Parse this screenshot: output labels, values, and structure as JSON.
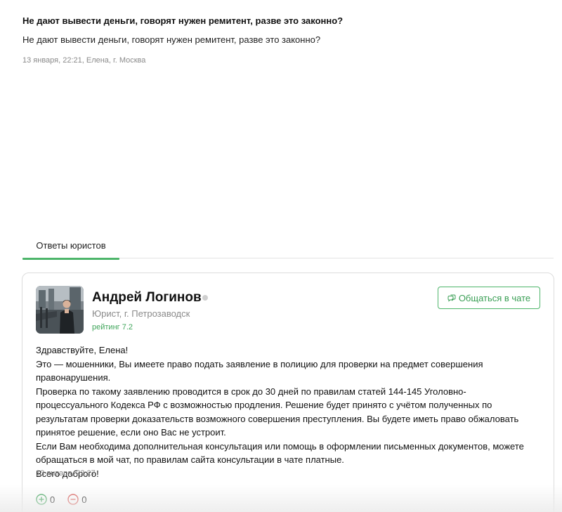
{
  "question": {
    "title": "Не дают вывести деньги, говорят нужен ремитент, разве это законно?",
    "body": "Не дают вывести деньги, говорят нужен ремитент, разве это законно?",
    "meta": "13 января, 22:21, Елена, г. Москва"
  },
  "tabs": {
    "answers_label": "Ответы юристов",
    "accent_color": "#4db56a"
  },
  "answer_card": {
    "avatar_icon": "lawyer-photo",
    "name": "Андрей Логинов",
    "status_icon": "offline-status-dot",
    "subtitle": "Юрист, г. Петрозаводск",
    "rating": "рейтинг 7.2",
    "chat_button_label": "Общаться в чате",
    "chat_icon": "chat-bubble-icon",
    "text": [
      "Здравствуйте, Елена!",
      "Это — мошенники, Вы имеете право подать заявление в полицию для проверки на предмет совершения правонарушения.",
      "Проверка по такому заявлению проводится в срок до 30 дней по правилам статей 144-145 Уголовно-процессуального Кодекса РФ с возможностью продления. Решение будет принято с учётом полученных по результатам проверки доказательств возможного совершения преступления. Вы будете иметь право обжаловать принятое решение, если оно Вас не устроит.",
      "Если Вам необходима дополнительная консультация или помощь в оформлении письменных документов, можете обращаться в мой чат, по правилам сайта консультации в чате платные.",
      "Всего доброго!"
    ],
    "meta": "13 января, 22:27",
    "votes": {
      "up": "0",
      "down": "0",
      "up_color": "#3fa55a",
      "down_color": "#d9534f"
    }
  }
}
